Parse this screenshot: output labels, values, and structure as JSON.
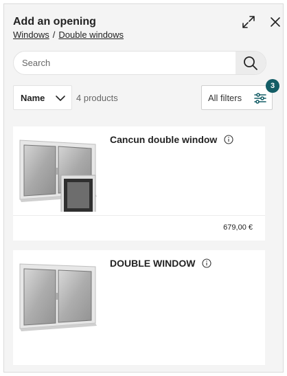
{
  "header": {
    "title": "Add an opening",
    "breadcrumb": [
      {
        "label": "Windows"
      },
      {
        "label": "Double windows"
      }
    ],
    "breadcrumb_separator": "/",
    "expand_icon": "expand-arrows-icon",
    "close_icon": "close-icon"
  },
  "search": {
    "placeholder": "Search",
    "value": "",
    "icon": "search-icon"
  },
  "toolbar": {
    "sort_label": "Name",
    "sort_icon": "chevron-down-icon",
    "count_text": "4 products",
    "filters_label": "All filters",
    "filters_icon": "sliders-icon",
    "filters_badge": "3",
    "badge_color": "#135d66"
  },
  "products": [
    {
      "name": "Cancun double window",
      "price": "679,00 €",
      "info_icon": "info-icon"
    },
    {
      "name": "DOUBLE WINDOW",
      "info_icon": "info-icon"
    }
  ]
}
